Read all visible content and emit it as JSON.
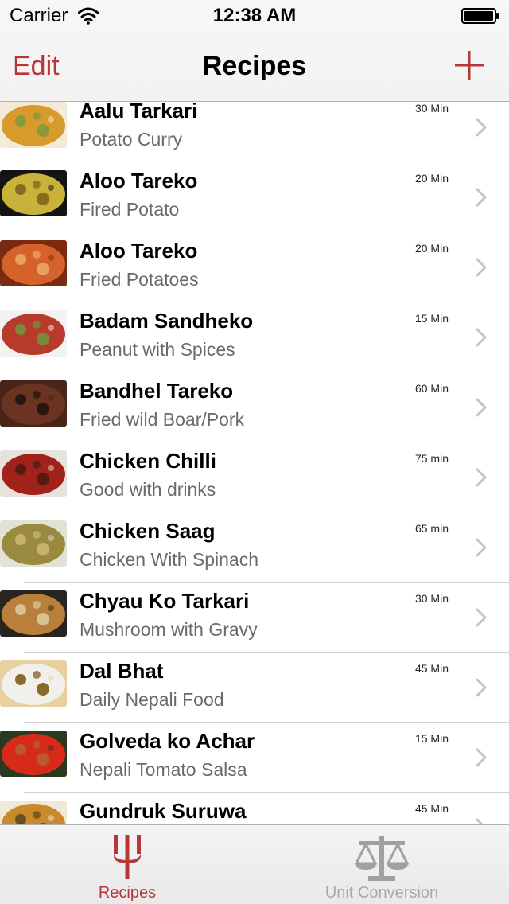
{
  "status_bar": {
    "carrier": "Carrier",
    "time": "12:38 AM"
  },
  "nav": {
    "edit_label": "Edit",
    "title": "Recipes",
    "add_icon": "plus-icon"
  },
  "colors": {
    "accent": "#b8353a",
    "inactive": "#a8a8a8",
    "separator": "#d0d0d0",
    "subtitle": "#6a6a6a"
  },
  "recipes": [
    {
      "name": "Aalu Tarkari",
      "description": "Potato Curry",
      "time": "30 Min"
    },
    {
      "name": "Aloo Tareko",
      "description": "Fired Potato",
      "time": "20 Min"
    },
    {
      "name": "Aloo Tareko",
      "description": "Fried Potatoes",
      "time": "20 Min"
    },
    {
      "name": "Badam Sandheko",
      "description": "Peanut with Spices",
      "time": "15 Min"
    },
    {
      "name": "Bandhel Tareko",
      "description": "Fried wild Boar/Pork",
      "time": "60 Min"
    },
    {
      "name": "Chicken Chilli",
      "description": "Good with drinks",
      "time": "75 min"
    },
    {
      "name": "Chicken Saag",
      "description": "Chicken With Spinach",
      "time": "65 min"
    },
    {
      "name": "Chyau Ko Tarkari",
      "description": "Mushroom with Gravy",
      "time": "30 Min"
    },
    {
      "name": "Dal Bhat",
      "description": "Daily Nepali Food",
      "time": "45 Min"
    },
    {
      "name": "Golveda ko Achar",
      "description": "Nepali Tomato Salsa",
      "time": "15 Min"
    },
    {
      "name": "Gundruk Suruwa",
      "description": "",
      "time": "45 Min"
    }
  ],
  "tab_bar": {
    "tabs": [
      {
        "label": "Recipes",
        "icon": "fork-icon",
        "selected": true
      },
      {
        "label": "Unit Conversion",
        "icon": "scale-icon",
        "selected": false
      }
    ]
  }
}
